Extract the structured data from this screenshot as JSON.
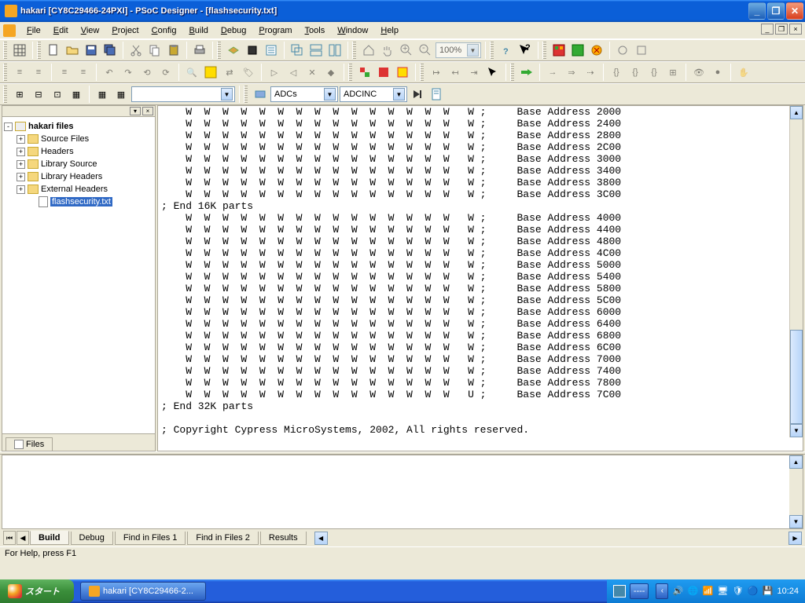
{
  "title": "hakari [CY8C29466-24PXI] - PSoC Designer - [flashsecurity.txt]",
  "menus": [
    "File",
    "Edit",
    "View",
    "Project",
    "Config",
    "Build",
    "Debug",
    "Program",
    "Tools",
    "Window",
    "Help"
  ],
  "zoom": "100%",
  "combo_category": "ADCs",
  "combo_module": "ADCINC",
  "tree": {
    "root": "hakari files",
    "items": [
      "Source Files",
      "Headers",
      "Library Source",
      "Library Headers",
      "External Headers"
    ],
    "selected": "flashsecurity.txt"
  },
  "sidebar_tab": "Files",
  "editor_addresses_a": [
    "2000",
    "2400",
    "2800",
    "2C00",
    "3000",
    "3400",
    "3800",
    "3C00"
  ],
  "editor_comment_16k": "; End 16K parts",
  "editor_addresses_b": [
    "4000",
    "4400",
    "4800",
    "4C00",
    "5000",
    "5400",
    "5800",
    "5C00",
    "6000",
    "6400",
    "6800",
    "6C00",
    "7000",
    "7400",
    "7800"
  ],
  "editor_last_row_char": "U",
  "editor_last_addr": "7C00",
  "editor_comment_32k": "; End 32K parts",
  "editor_copyright": "; Copyright Cypress MicroSystems, 2002, All rights reserved.",
  "base_addr_label": "Base Address",
  "row_char": "W",
  "out_tabs": [
    "Build",
    "Debug",
    "Find in Files 1",
    "Find in Files 2",
    "Results"
  ],
  "out_active": "Build",
  "status": "For Help, press F1",
  "start_label": "スタート",
  "task_label": "hakari [CY8C29466-2...",
  "lang": "----",
  "clock": "10:24"
}
